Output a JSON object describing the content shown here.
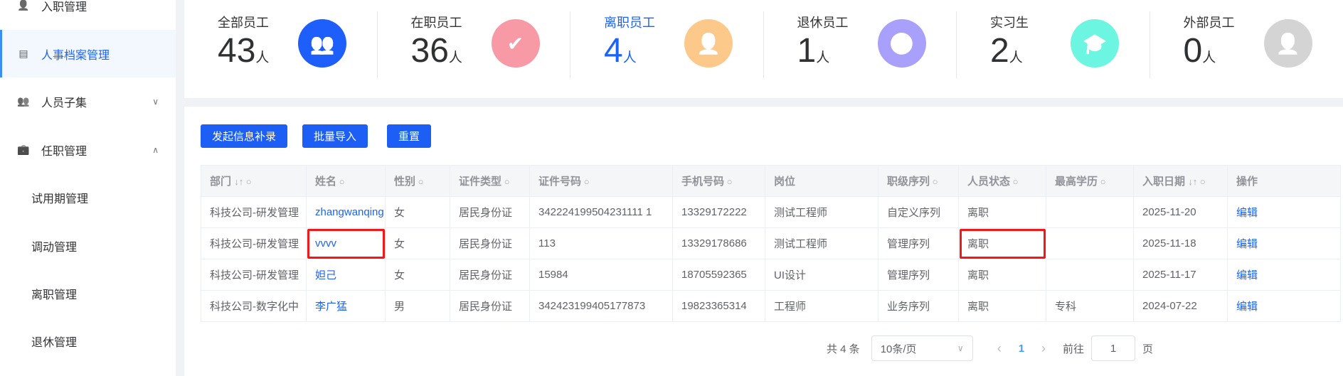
{
  "sidebar": {
    "items": [
      {
        "label": "入职管理",
        "icon": "user-add-icon"
      },
      {
        "label": "人事档案管理",
        "icon": "document-icon",
        "active": true
      },
      {
        "label": "人员子集",
        "icon": "users-icon",
        "chevron": "∨"
      },
      {
        "label": "任职管理",
        "icon": "briefcase-icon",
        "chevron": "∧"
      },
      {
        "label": "试用期管理"
      },
      {
        "label": "调动管理"
      },
      {
        "label": "离职管理"
      },
      {
        "label": "退休管理"
      }
    ]
  },
  "stats": [
    {
      "label": "全部员工",
      "value": "43",
      "unit": "人",
      "color": "#1e5efb",
      "icon": "users-icon"
    },
    {
      "label": "在职员工",
      "value": "36",
      "unit": "人",
      "color": "#f79aa5",
      "icon": "user-check-icon"
    },
    {
      "label": "离职员工",
      "value": "4",
      "unit": "人",
      "color": "#fdc98a",
      "icon": "user-leave-icon",
      "active": true
    },
    {
      "label": "退休员工",
      "value": "1",
      "unit": "人",
      "color": "#a9a0fb",
      "icon": "user-clock-icon"
    },
    {
      "label": "实习生",
      "value": "2",
      "unit": "人",
      "color": "#6cf5e0",
      "icon": "graduation-cap-icon"
    },
    {
      "label": "外部员工",
      "value": "0",
      "unit": "人",
      "color": "#d4d4d4",
      "icon": "user-external-icon"
    }
  ],
  "toolbar": {
    "supplement": "发起信息补录",
    "import": "批量导入",
    "reset": "重置"
  },
  "table": {
    "headers": [
      "部门",
      "姓名",
      "性别",
      "证件类型",
      "证件号码",
      "手机号码",
      "岗位",
      "职级序列",
      "人员状态",
      "最高学历",
      "入职日期",
      "操作"
    ],
    "rows": [
      [
        "科技公司-研发管理",
        "zhangwanqing",
        "女",
        "居民身份证",
        "342224199504231111 1",
        "13329172222",
        "测试工程师",
        "自定义序列",
        "离职",
        "",
        "2025-11-20",
        "编辑"
      ],
      [
        "科技公司-研发管理",
        "vvvv",
        "女",
        "居民身份证",
        "113",
        "13329178686",
        "测试工程师",
        "管理序列",
        "离职",
        "",
        "2025-11-18",
        "编辑"
      ],
      [
        "科技公司-研发管理",
        "妲己",
        "女",
        "居民身份证",
        "15984",
        "18705592365",
        "UI设计",
        "管理序列",
        "离职",
        "",
        "2025-11-17",
        "编辑"
      ],
      [
        "科技公司-数字化中",
        "李广猛",
        "男",
        "居民身份证",
        "342423199405177873",
        "19823365314",
        "工程师",
        "业务序列",
        "离职",
        "专科",
        "2024-07-22",
        "编辑"
      ]
    ]
  },
  "pagination": {
    "total": "共 4 条",
    "page_size": "10条/页",
    "current": "1",
    "goto_label": "前往",
    "goto_value": "1",
    "page_suffix": "页",
    "prev": "‹",
    "next": "›"
  }
}
